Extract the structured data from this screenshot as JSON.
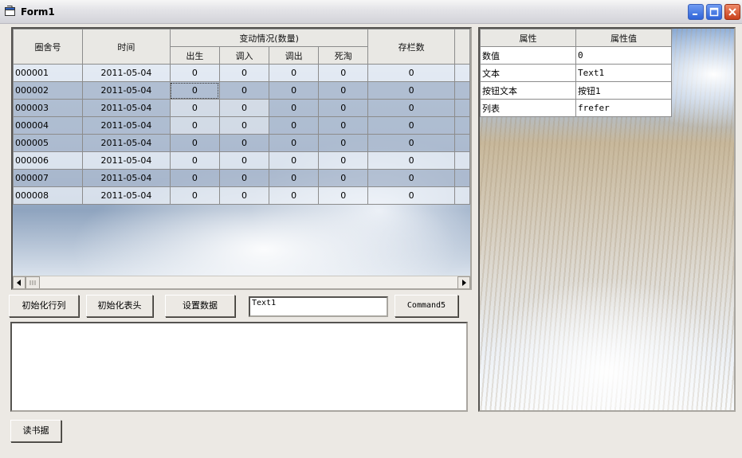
{
  "window": {
    "title": "Form1"
  },
  "grid": {
    "col_code": "圈舍号",
    "col_time": "时间",
    "col_group": "变动情况(数量)",
    "col_sub": [
      "出生",
      "调入",
      "调出",
      "死淘"
    ],
    "col_stock": "存栏数",
    "rows": [
      [
        "000001",
        "2011-05-04",
        "0",
        "0",
        "0",
        "0",
        "0"
      ],
      [
        "000002",
        "2011-05-04",
        "0",
        "0",
        "0",
        "0",
        "0"
      ],
      [
        "000003",
        "2011-05-04",
        "0",
        "0",
        "0",
        "0",
        "0"
      ],
      [
        "000004",
        "2011-05-04",
        "0",
        "0",
        "0",
        "0",
        "0"
      ],
      [
        "000005",
        "2011-05-04",
        "0",
        "0",
        "0",
        "0",
        "0"
      ],
      [
        "000006",
        "2011-05-04",
        "0",
        "0",
        "0",
        "0",
        "0"
      ],
      [
        "000007",
        "2011-05-04",
        "0",
        "0",
        "0",
        "0",
        "0"
      ],
      [
        "000008",
        "2011-05-04",
        "0",
        "0",
        "0",
        "0",
        "0"
      ]
    ]
  },
  "buttons": {
    "init_rows": "初始化行列",
    "init_header": "初始化表头",
    "set_data": "设置数据",
    "command5": "Command5",
    "read_data": "读书据"
  },
  "text1": {
    "value": "Text1"
  },
  "props": {
    "header_name": "属性",
    "header_value": "属性值",
    "rows": [
      {
        "name": "数值",
        "value": "0"
      },
      {
        "name": "文本",
        "value": "Text1"
      },
      {
        "name": "按钮文本",
        "value": "按钮1"
      },
      {
        "name": "列表",
        "value": "frefer"
      }
    ]
  }
}
